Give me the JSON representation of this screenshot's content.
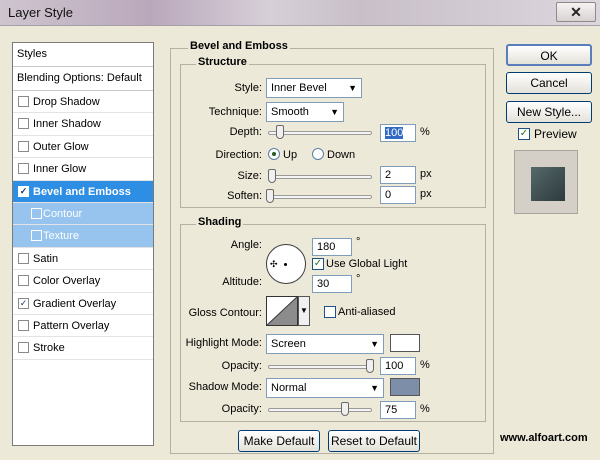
{
  "window": {
    "title": "Layer Style",
    "close_glyph": "✕"
  },
  "styles_list": {
    "header": "Styles",
    "blending_options": "Blending Options: Default",
    "items": [
      {
        "label": "Drop Shadow",
        "checked": false
      },
      {
        "label": "Inner Shadow",
        "checked": false
      },
      {
        "label": "Outer Glow",
        "checked": false
      },
      {
        "label": "Inner Glow",
        "checked": false
      },
      {
        "label": "Bevel and Emboss",
        "checked": true
      },
      {
        "label": "Contour",
        "checked": false
      },
      {
        "label": "Texture",
        "checked": false
      },
      {
        "label": "Satin",
        "checked": false
      },
      {
        "label": "Color Overlay",
        "checked": false
      },
      {
        "label": "Gradient Overlay",
        "checked": true
      },
      {
        "label": "Pattern Overlay",
        "checked": false
      },
      {
        "label": "Stroke",
        "checked": false
      }
    ]
  },
  "bevel": {
    "title": "Bevel and Emboss",
    "structure": {
      "title": "Structure",
      "style_label": "Style:",
      "style_value": "Inner Bevel",
      "technique_label": "Technique:",
      "technique_value": "Smooth",
      "depth_label": "Depth:",
      "depth_value": "100",
      "depth_unit": "%",
      "depth_fraction": 0.1,
      "direction_label": "Direction:",
      "direction_up": "Up",
      "direction_down": "Down",
      "direction_selected": "Up",
      "size_label": "Size:",
      "size_value": "2",
      "size_unit": "px",
      "size_fraction": 0.02,
      "soften_label": "Soften:",
      "soften_value": "0",
      "soften_unit": "px",
      "soften_fraction": 0
    },
    "shading": {
      "title": "Shading",
      "angle_label": "Angle:",
      "angle_value": "180",
      "angle_unit": "°",
      "use_global_light": "Use Global Light",
      "use_global_light_checked": true,
      "altitude_label": "Altitude:",
      "altitude_value": "30",
      "altitude_unit": "°",
      "gloss_contour_label": "Gloss Contour:",
      "anti_aliased": "Anti-aliased",
      "anti_aliased_checked": false,
      "highlight_mode_label": "Highlight Mode:",
      "highlight_mode_value": "Screen",
      "highlight_color": "#ffffff",
      "highlight_opacity_label": "Opacity:",
      "highlight_opacity_value": "100",
      "highlight_opacity_unit": "%",
      "highlight_opacity_fraction": 1.0,
      "shadow_mode_label": "Shadow Mode:",
      "shadow_mode_value": "Normal",
      "shadow_color": "#7d8ea8",
      "shadow_opacity_label": "Opacity:",
      "shadow_opacity_value": "75",
      "shadow_opacity_unit": "%",
      "shadow_opacity_fraction": 0.75
    },
    "make_default": "Make Default",
    "reset_default": "Reset to Default"
  },
  "actions": {
    "ok": "OK",
    "cancel": "Cancel",
    "new_style": "New Style...",
    "preview_label": "Preview",
    "preview_checked": true
  },
  "watermark": "www.alfoart.com",
  "icons": {
    "checkmark": "✓",
    "dropdown": "▼",
    "contour_dropdown": "▼",
    "crosshair": "✣"
  }
}
